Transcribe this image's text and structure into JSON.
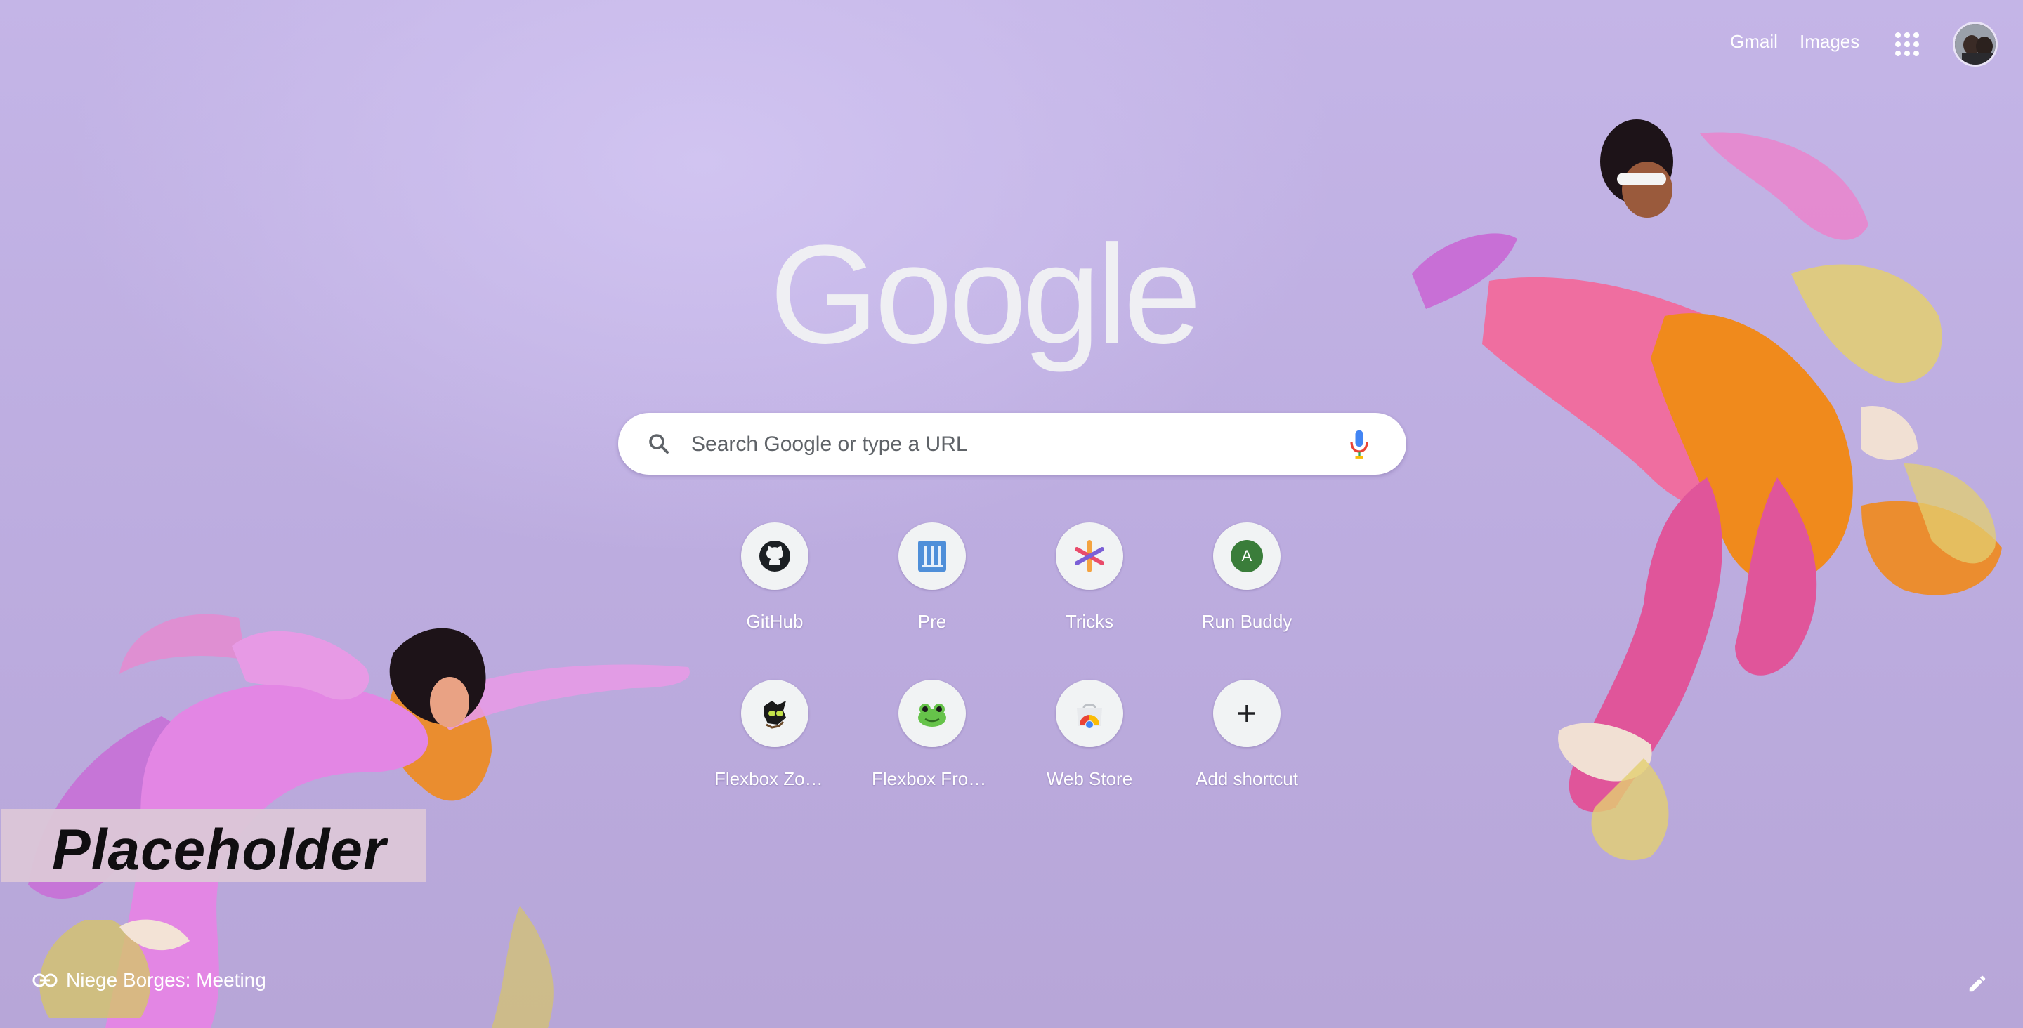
{
  "header": {
    "gmail_label": "Gmail",
    "images_label": "Images"
  },
  "logo": {
    "text": "Google"
  },
  "search": {
    "placeholder": "Search Google or type a URL"
  },
  "shortcuts": [
    {
      "label": "GitHub",
      "icon": "github-icon"
    },
    {
      "label": "Pre",
      "icon": "pre-icon"
    },
    {
      "label": "Tricks",
      "icon": "tricks-icon"
    },
    {
      "label": "Run Buddy",
      "icon": "run-buddy-icon",
      "letter": "A"
    },
    {
      "label": "Flexbox Zom…",
      "icon": "flexbox-zombies-icon"
    },
    {
      "label": "Flexbox Froggy",
      "icon": "frog-icon"
    },
    {
      "label": "Web Store",
      "icon": "chrome-web-store-icon"
    },
    {
      "label": "Add shortcut",
      "icon": "plus-icon"
    }
  ],
  "overlay": {
    "placeholder_text": "Placeholder"
  },
  "attribution": {
    "text": "Niege Borges: Meeting"
  },
  "colors": {
    "background": "#c4b5e7",
    "logo": "#efeff3",
    "run_buddy_badge": "#3a7d3a",
    "mic_blue": "#4285f4",
    "mic_red": "#ea4335"
  }
}
